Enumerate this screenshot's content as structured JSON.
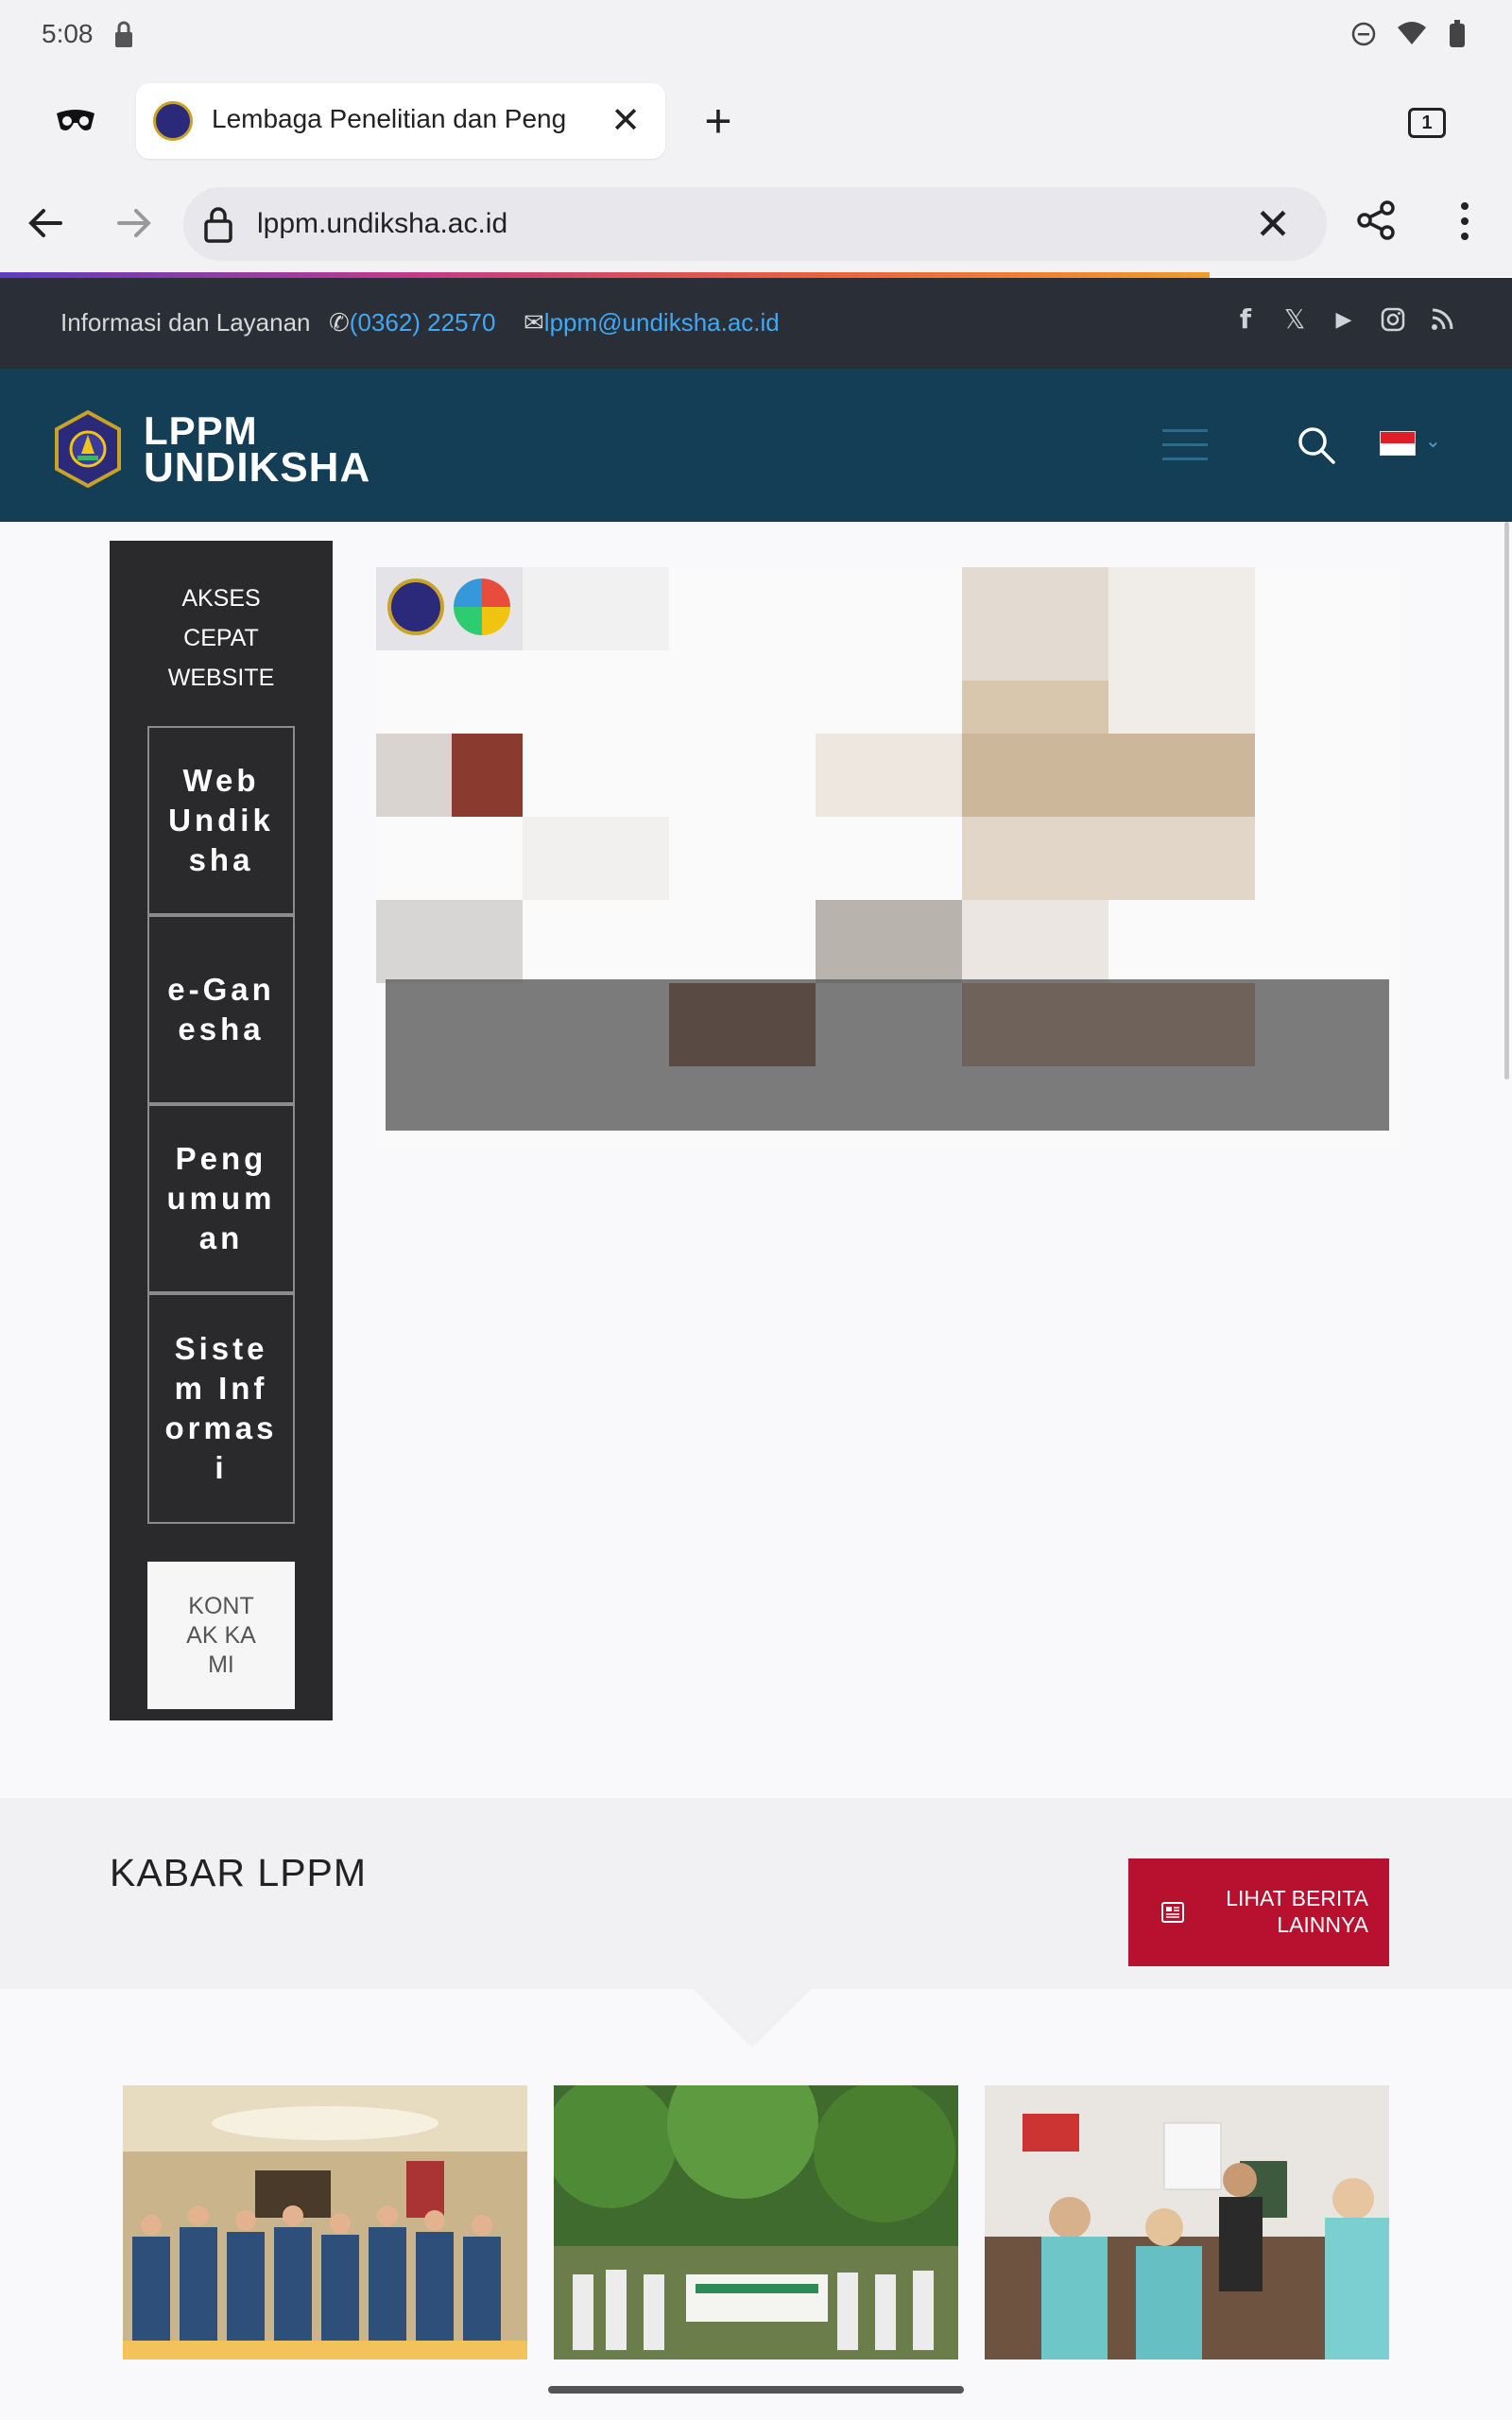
{
  "status_bar": {
    "time": "5:08"
  },
  "browser": {
    "tab_title": "Lembaga Penelitian dan Peng",
    "tab_count": "1",
    "url": "lppm.undiksha.ac.id"
  },
  "topbar": {
    "info_label": "Informasi dan Layanan",
    "phone": "(0362) 22570",
    "email": "lppm@undiksha.ac.id",
    "socials": [
      "facebook-icon",
      "x-icon",
      "youtube-icon",
      "instagram-icon",
      "rss-icon"
    ]
  },
  "header": {
    "logo_line1": "LPPM",
    "logo_line2": "UNDIKSHA",
    "flag_colors": [
      "#e11d2a",
      "#ffffff"
    ]
  },
  "quick_access": {
    "title_lines": [
      "AKSES",
      "CEPAT",
      "WEBSITE"
    ],
    "items": [
      "Web Undiksha",
      "e-Ganesha",
      "Pengumuman",
      "Sistem Informasi"
    ],
    "contact": "KONTAK KAMI"
  },
  "news": {
    "title": "KABAR LPPM",
    "more_button": "LIHAT BERITA LAINNYA"
  },
  "colors": {
    "header_bg": "#133e55",
    "topbar_bg": "#2a2e36",
    "panel_bg": "#2a2a2d",
    "accent_red": "#b8102f",
    "link_blue": "#3fa9f5"
  }
}
